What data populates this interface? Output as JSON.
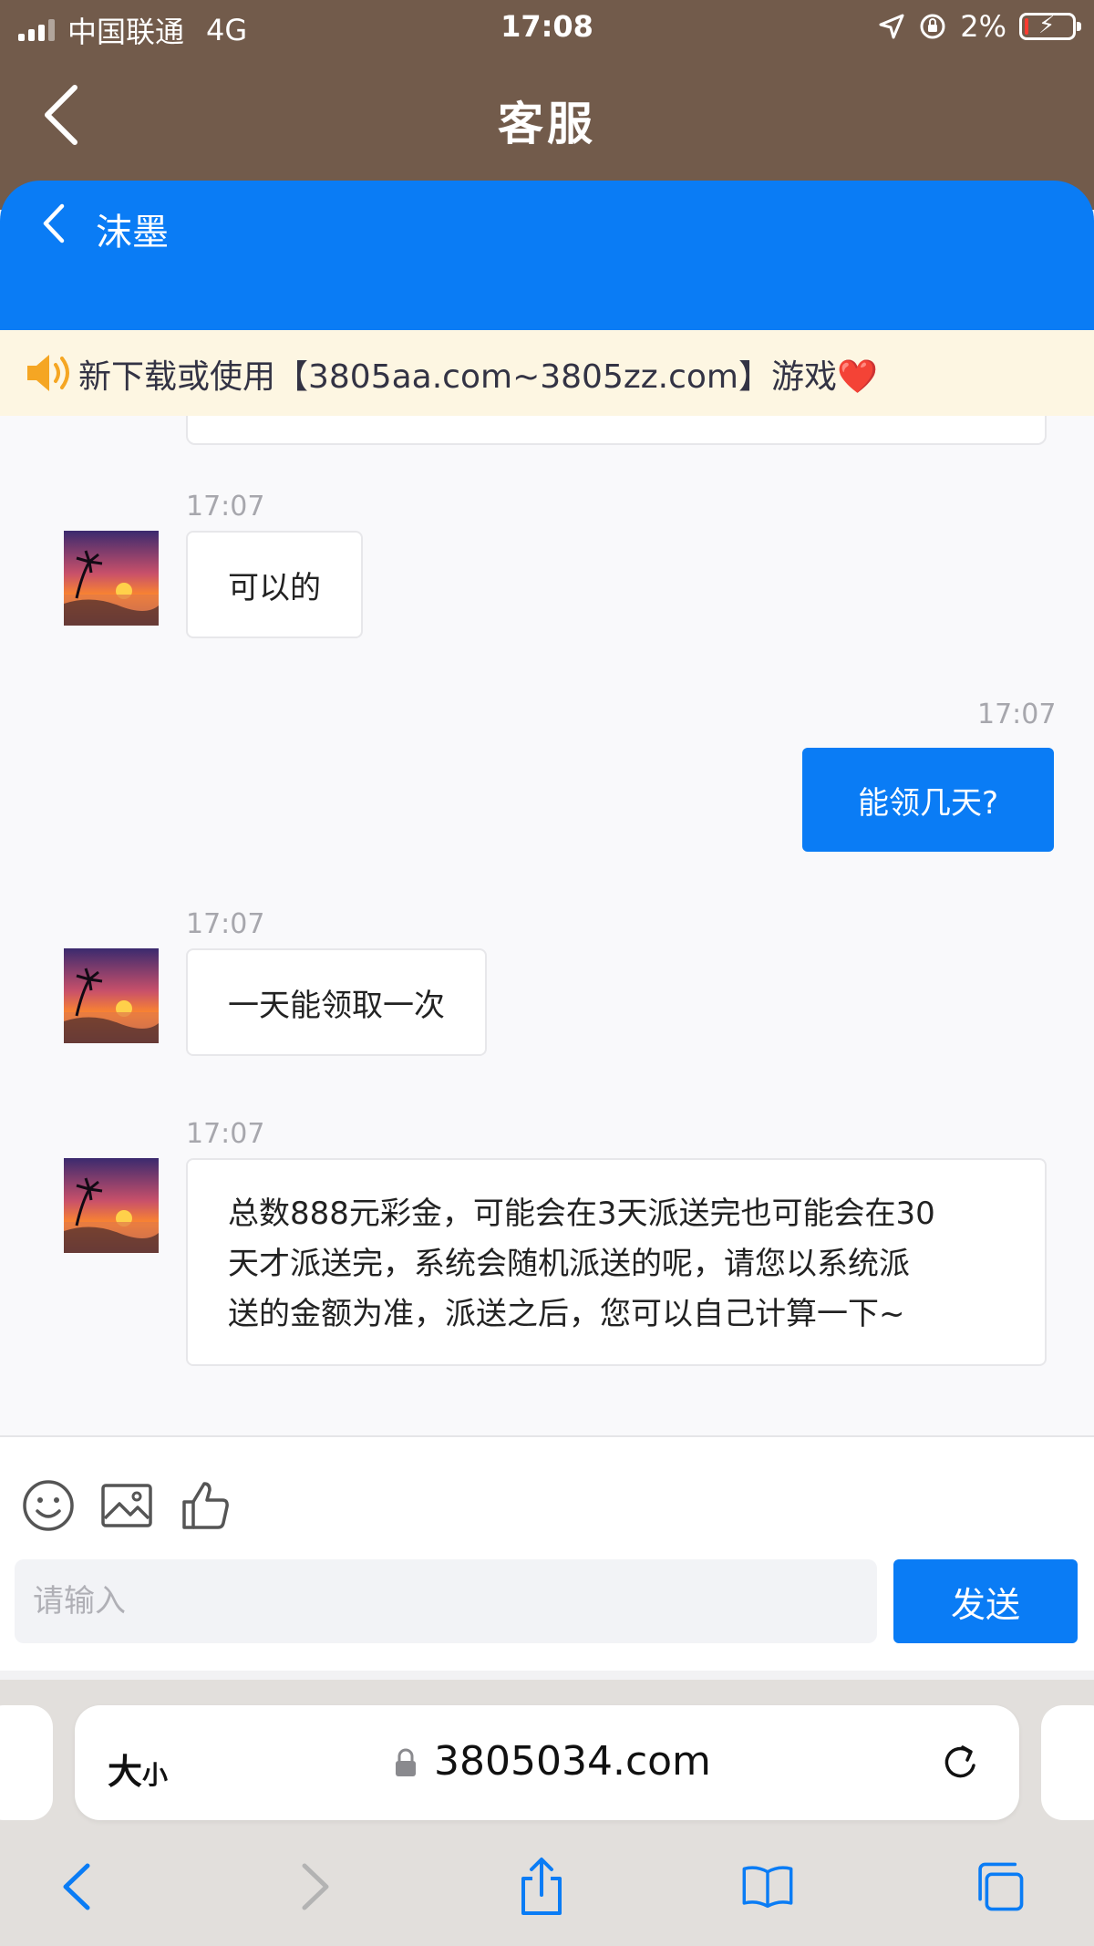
{
  "status_bar": {
    "carrier": "中国联通",
    "network": "4G",
    "time": "17:08",
    "battery": "2%"
  },
  "app_header": {
    "title": "客服"
  },
  "chat_header": {
    "contact_name": "沫墨"
  },
  "notice": {
    "text": "新下载或使用【3805aa.com~3805zz.com】游戏"
  },
  "messages": [
    {
      "side": "in",
      "time": "17:07",
      "text": "可以的"
    },
    {
      "side": "out",
      "time": "17:07",
      "text": "能领几天?"
    },
    {
      "side": "in",
      "time": "17:07",
      "text": "一天能领取一次"
    },
    {
      "side": "in",
      "time": "17:07",
      "text_lines": [
        "总数888元彩金，可能会在3天派送完也可能会在30",
        "天才派送完，系统会随机派送的呢，请您以系统派",
        "送的金额为准，派送之后，您可以自己计算一下~"
      ]
    }
  ],
  "input": {
    "placeholder": "请输入",
    "value": "",
    "send_label": "发送"
  },
  "browser": {
    "text_size_label": "大",
    "text_size_small": "小",
    "url": "3805034.com"
  },
  "colors": {
    "header_brown": "#725b4b",
    "accent_blue": "#0a7cf5",
    "notice_bg": "#fdf6e2"
  }
}
